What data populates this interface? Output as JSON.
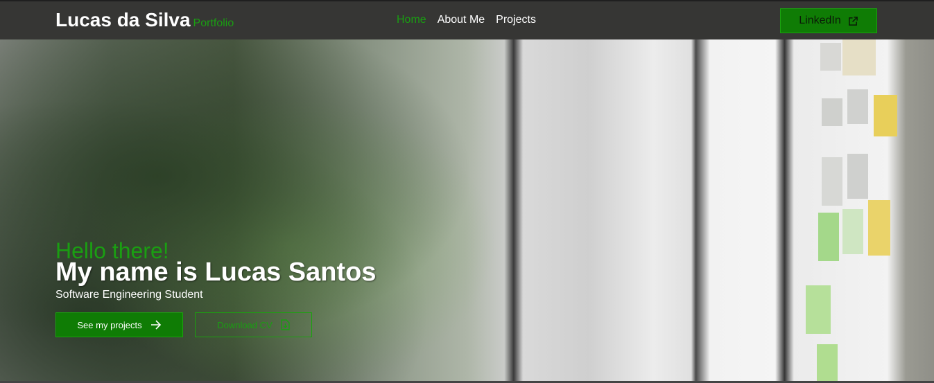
{
  "nav": {
    "brand": "Lucas da Silva",
    "brand_sub": "Portfolio",
    "links": [
      {
        "label": "Home"
      },
      {
        "label": "About Me"
      },
      {
        "label": "Projects"
      }
    ],
    "linkedin_label": "LinkedIn"
  },
  "hero": {
    "greeting": "Hello there!",
    "headline": "My name is Lucas Santos",
    "subtitle": "Software Engineering Student",
    "projects_button": "See my projects",
    "cv_button": "Download CV"
  },
  "colors": {
    "accent": "#1a9e12",
    "button": "#0f7c05",
    "navbar": "#363634"
  }
}
